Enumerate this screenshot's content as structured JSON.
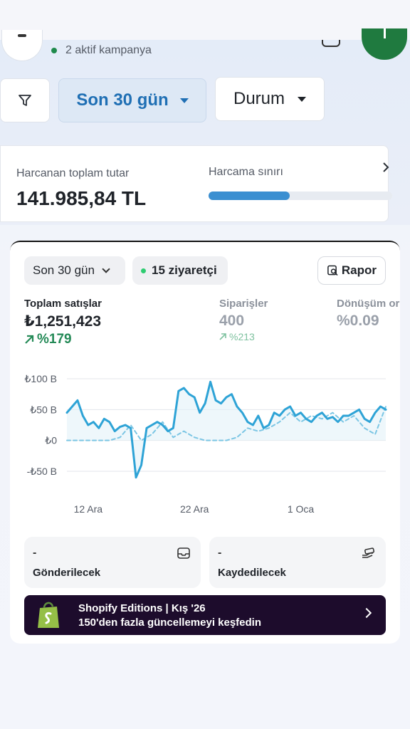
{
  "header": {
    "campaign_status": "2 aktif kampanya"
  },
  "filters": {
    "range_label": "Son 30 gün",
    "status_label": "Durum"
  },
  "spend": {
    "total_label": "Harcanan toplam tutar",
    "total_value": "141.985,84 TL",
    "limit_label": "Harcama sınırı",
    "limit_progress": 0.44
  },
  "store": {
    "period_label": "Son 30 gün",
    "visitors_label": "15 ziyaretçi",
    "report_label": "Rapor",
    "metrics": [
      {
        "title": "Toplam satışlar",
        "value": "₺1,251,423",
        "change": "%179"
      },
      {
        "title": "Siparişler",
        "value": "400",
        "change": "%213"
      },
      {
        "title": "Dönüşüm or",
        "value": "%0.09"
      }
    ],
    "to_ship": {
      "value": "-",
      "label": "Gönderilecek"
    },
    "to_record": {
      "value": "-",
      "label": "Kaydedilecek"
    },
    "promo": {
      "title": "Shopify Editions | Kış '26",
      "subtitle": "150'den fazla güncellemeyi keşfedin"
    }
  },
  "chart_data": {
    "type": "line",
    "ylim": [
      -50,
      100
    ],
    "y_tick_labels": [
      "₺100 B",
      "₺50 B",
      "₺0",
      "-₺50 B"
    ],
    "y_ticks": [
      100,
      50,
      0,
      -50
    ],
    "x_tick_labels": [
      "12 Ara",
      "22 Ara",
      "1 Oca"
    ],
    "x_ticks": [
      2,
      12,
      22
    ],
    "series": [
      {
        "style": "solid",
        "color": "#2ea3d6",
        "x": [
          0,
          0.5,
          1,
          1.5,
          2,
          2.5,
          3,
          3.5,
          4,
          4.5,
          5,
          5.5,
          6,
          6.5,
          7,
          7.5,
          8,
          8.5,
          9,
          9.5,
          10,
          10.5,
          11,
          11.5,
          12,
          12.5,
          13,
          13.5,
          14,
          14.5,
          15,
          15.5,
          16,
          16.5,
          17,
          17.5,
          18,
          18.5,
          19,
          19.5,
          20,
          20.5,
          21,
          21.5,
          22,
          22.5,
          23,
          23.5,
          24,
          24.5,
          25,
          25.5,
          26,
          26.5,
          27,
          27.5,
          28,
          28.5,
          29,
          29.5,
          30
        ],
        "values": [
          45,
          55,
          65,
          40,
          25,
          30,
          20,
          35,
          30,
          15,
          22,
          25,
          20,
          -60,
          -40,
          20,
          25,
          30,
          25,
          15,
          20,
          80,
          85,
          75,
          70,
          45,
          60,
          95,
          65,
          60,
          70,
          75,
          55,
          45,
          30,
          25,
          40,
          20,
          25,
          45,
          40,
          50,
          55,
          40,
          45,
          35,
          30,
          40,
          45,
          35,
          38,
          30,
          40,
          40,
          45,
          50,
          35,
          30,
          45,
          55,
          50
        ]
      },
      {
        "style": "dashed",
        "color": "#7cc6e4",
        "x": [
          0,
          1,
          2,
          3,
          4,
          5,
          6,
          7,
          8,
          9,
          10,
          11,
          12,
          13,
          14,
          15,
          16,
          17,
          18,
          19,
          20,
          21,
          22,
          23,
          24,
          25,
          26,
          27,
          28,
          29,
          30
        ],
        "values": [
          0,
          0,
          0,
          0,
          0,
          5,
          25,
          0,
          10,
          30,
          5,
          15,
          5,
          0,
          0,
          0,
          5,
          20,
          15,
          20,
          30,
          45,
          30,
          40,
          35,
          45,
          30,
          40,
          20,
          10,
          55
        ]
      }
    ]
  }
}
